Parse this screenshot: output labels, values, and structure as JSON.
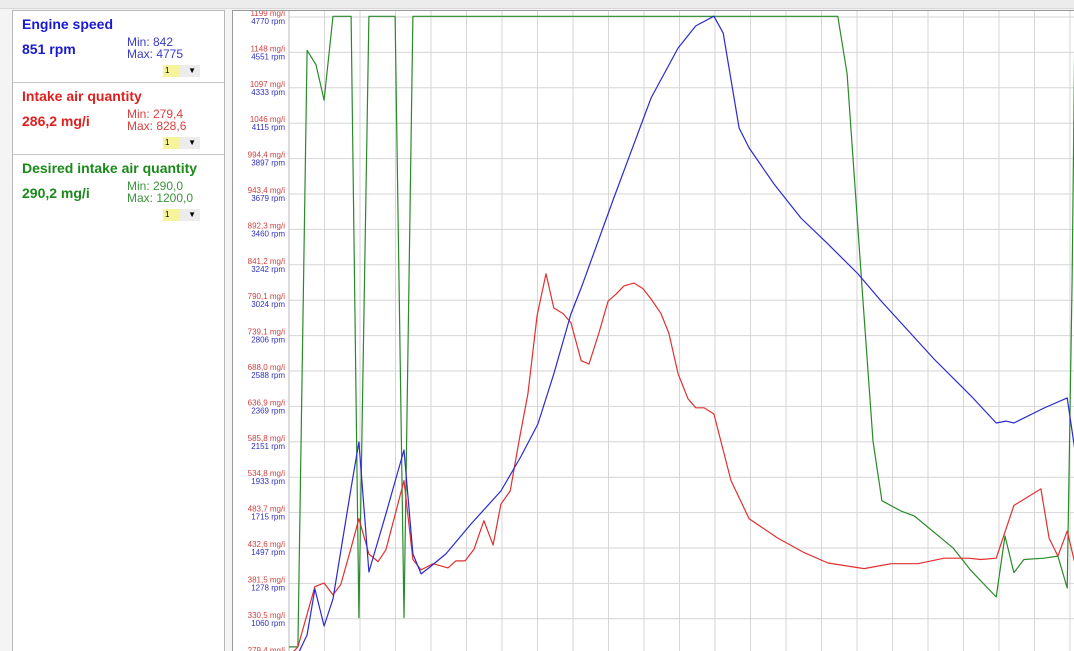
{
  "channels": [
    {
      "title": "Engine speed",
      "value": "851 rpm",
      "min": "Min: 842",
      "max": "Max: 4775",
      "scale": "1",
      "color": "#1a1ad0"
    },
    {
      "title": "Intake air quantity",
      "value": "286,2 mg/i",
      "min": "Min: 279,4",
      "max": "Max: 828,6",
      "scale": "1",
      "color": "#e02020"
    },
    {
      "title": "Desired intake air quantity",
      "value": "290,2 mg/i",
      "min": "Min: 290,0",
      "max": "Max: 1200,0",
      "scale": "1",
      "color": "#1a8a1a"
    }
  ],
  "chart_data": {
    "type": "line",
    "xlabel": "",
    "ylabel": "",
    "x_unit": "grid divisions",
    "xlim": [
      0,
      22.14
    ],
    "grid": true,
    "y_ticks_mg": [
      "1199 mg/i",
      "1148 mg/i",
      "1097 mg/i",
      "1046 mg/i",
      "994,4 mg/i",
      "943,4 mg/i",
      "892,3 mg/i",
      "841,2 mg/i",
      "790,1 mg/i",
      "739,1 mg/i",
      "688,0 mg/i",
      "636,9 mg/i",
      "585,8 mg/i",
      "534,8 mg/i",
      "483,7 mg/i",
      "432,6 mg/i",
      "381,5 mg/i",
      "330,5 mg/i",
      "279,4 mg/i"
    ],
    "y_ticks_rpm": [
      "4770 rpm",
      "4551 rpm",
      "4333 rpm",
      "4115 rpm",
      "3897 rpm",
      "3679 rpm",
      "3460 rpm",
      "3242 rpm",
      "3024 rpm",
      "2806 rpm",
      "2588 rpm",
      "2369 rpm",
      "2151 rpm",
      "1933 rpm",
      "1715 rpm",
      "1497 rpm",
      "1278 rpm",
      "1060 rpm",
      "842 rpm"
    ],
    "ylim_mg": [
      279.4,
      1199
    ],
    "ylim_rpm": [
      842,
      4770
    ],
    "series": [
      {
        "name": "Engine speed",
        "unit": "rpm",
        "color": "#2a2ad0",
        "x": [
          0.25,
          0.51,
          0.73,
          0.99,
          1.24,
          1.75,
          1.97,
          2.25,
          2.73,
          3.24,
          3.49,
          3.72,
          3.94,
          4.42,
          5.13,
          5.97,
          6.54,
          7.01,
          7.46,
          7.94,
          8.23,
          9.15,
          10.2,
          10.96,
          11.46,
          11.97,
          12.23,
          12.68,
          12.96,
          13.66,
          14.42,
          15.18,
          16.03,
          16.68,
          18.17,
          19.21,
          19.92,
          20.2,
          20.42,
          21.27,
          21.92,
          22.14
        ],
        "y": [
          842,
          961,
          1244,
          1016,
          1183,
          1867,
          2150,
          1349,
          1707,
          2101,
          1460,
          1337,
          1374,
          1460,
          1645,
          1848,
          2064,
          2261,
          2570,
          2939,
          3100,
          3654,
          4271,
          4579,
          4715,
          4775,
          4671,
          4086,
          3963,
          3741,
          3531,
          3371,
          3186,
          3019,
          2662,
          2434,
          2267,
          2279,
          2267,
          2360,
          2422,
          2095
        ]
      },
      {
        "name": "Intake air quantity",
        "unit": "mg/i",
        "color": "#e03030",
        "x": [
          0.06,
          0.25,
          0.73,
          0.99,
          1.24,
          1.46,
          1.75,
          1.97,
          2.25,
          2.51,
          2.73,
          3.24,
          3.49,
          3.72,
          4.06,
          4.48,
          4.7,
          4.96,
          5.21,
          5.49,
          5.75,
          5.97,
          6.23,
          6.48,
          6.73,
          6.99,
          7.24,
          7.46,
          7.72,
          7.94,
          8.23,
          8.45,
          8.73,
          8.99,
          9.21,
          9.44,
          9.72,
          9.97,
          10.2,
          10.48,
          10.7,
          10.96,
          11.24,
          11.46,
          11.69,
          11.97,
          12.45,
          12.96,
          13.77,
          14.51,
          15.18,
          16.2,
          16.96,
          17.24,
          17.72,
          18.45,
          19.13,
          19.49,
          19.92,
          20.42,
          21.18,
          21.41,
          21.66,
          21.92,
          22.14
        ],
        "y": [
          279.4,
          290,
          377,
          382,
          365,
          380,
          433,
          475,
          424,
          413,
          430,
          530,
          416,
          401,
          410,
          404,
          414,
          414,
          431,
          472,
          437,
          496,
          515,
          587,
          655,
          768,
          828.6,
          779,
          771,
          758,
          703,
          698,
          743,
          789,
          799,
          811,
          815,
          807,
          792,
          771,
          743,
          684,
          648,
          635,
          635,
          626,
          530,
          475,
          447,
          426,
          411,
          403,
          410,
          410,
          410,
          418,
          418,
          416,
          418,
          494,
          518,
          447,
          421,
          457,
          410
        ]
      },
      {
        "name": "Desired intake air quantity",
        "unit": "mg/i",
        "color": "#2a8a2a",
        "x": [
          0,
          0.25,
          0.51,
          0.76,
          0.99,
          1.24,
          1.75,
          1.97,
          2.25,
          2.99,
          3.24,
          3.49,
          15.46,
          15.72,
          16.17,
          16.45,
          16.7,
          17.24,
          17.61,
          18.7,
          19.21,
          19.92,
          20.17,
          20.42,
          20.7,
          21.27,
          21.66,
          21.92,
          22.06,
          22.14
        ],
        "y": [
          290,
          290,
          1151,
          1130,
          1079,
          1200,
          1200,
          332,
          1200,
          1200,
          332,
          1200,
          1200,
          1117,
          789,
          587,
          501,
          486,
          479,
          433,
          400,
          362,
          450,
          397,
          416,
          418,
          421,
          375,
          818,
          1200
        ]
      }
    ]
  }
}
